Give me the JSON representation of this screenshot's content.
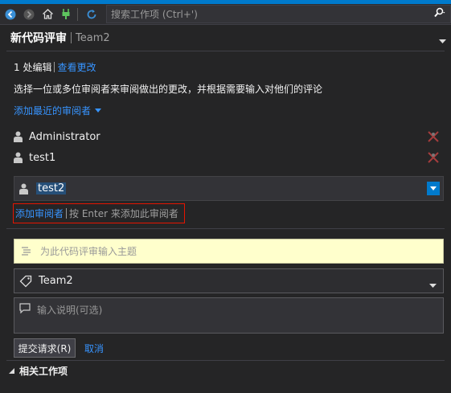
{
  "toolbar": {
    "search_placeholder": "搜索工作项 (Ctrl+')"
  },
  "header": {
    "title": "新代码评审",
    "team": "Team2"
  },
  "edits": {
    "count_label": "1 处编辑",
    "view_changes": "查看更改"
  },
  "instructions": "选择一位或多位审阅者来审阅做出的更改，并根据需要输入对他们的评论",
  "add_recent": "添加最近的审阅者",
  "reviewers": [
    {
      "name": "Administrator"
    },
    {
      "name": "test1"
    }
  ],
  "reviewer_input": {
    "value": "test2"
  },
  "add_hint": {
    "link": "添加审阅者",
    "text": "按 Enter 来添加此审阅者"
  },
  "subject_placeholder": "为此代码评审输入主题",
  "team_select": {
    "value": "Team2"
  },
  "notes_placeholder": "输入说明(可选)",
  "actions": {
    "submit": "提交请求(R)",
    "cancel": "取消"
  },
  "related_section": "相关工作项",
  "colors": {
    "background": "#252526",
    "accent": "#007acc",
    "link": "#3794ff",
    "highlight_border": "#e51400",
    "subject_bg": "#ffffcc"
  }
}
